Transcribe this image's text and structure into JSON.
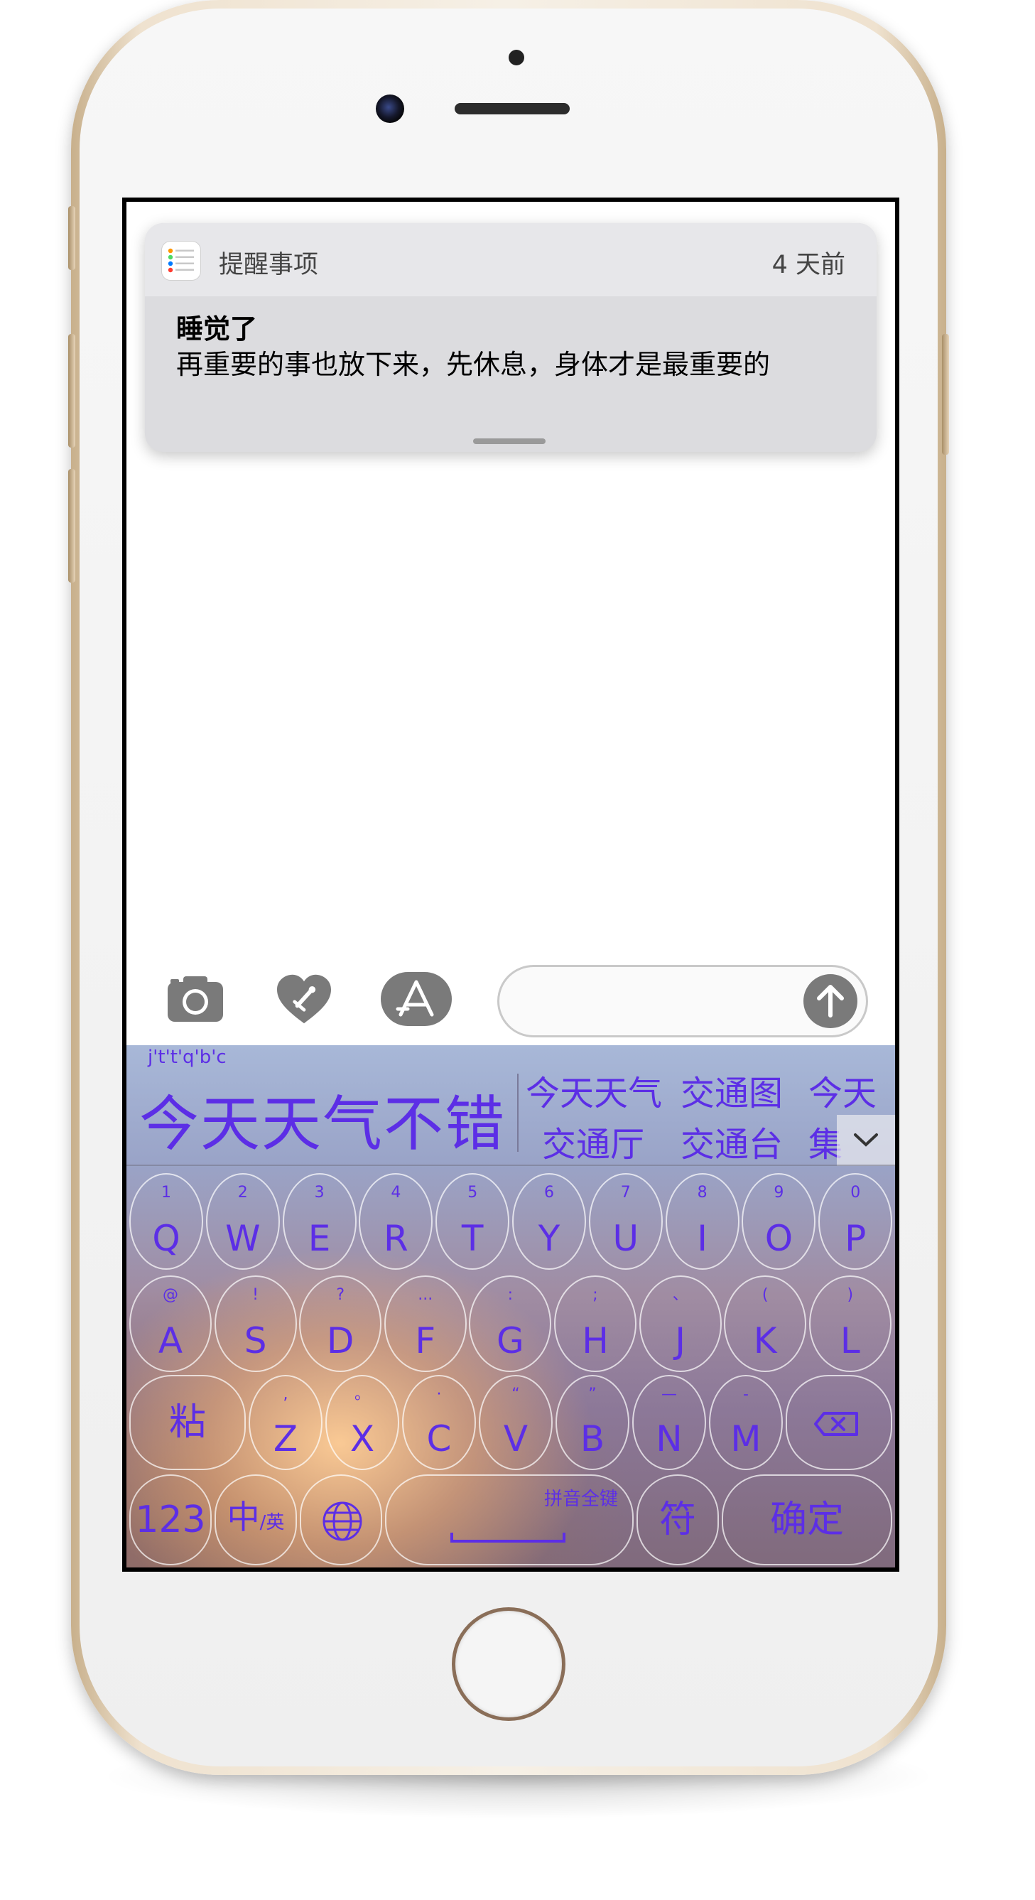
{
  "notification": {
    "app_name": "提醒事项",
    "time_ago": "4 天前",
    "title": "睡觉了",
    "message": "再重要的事也放下来，先休息，身体才是最重要的"
  },
  "message_toolbar": {
    "icons": [
      "camera-icon",
      "heart-icon",
      "app-store-icon"
    ],
    "send_icon": "arrow-up-icon"
  },
  "keyboard": {
    "pinyin": "j't't'q'b'c",
    "main_candidate": "今天天气不错",
    "candidates_row1": [
      "今天天气",
      "交通图",
      "今天"
    ],
    "candidates_row2": [
      "交通厅",
      "交通台",
      "集"
    ],
    "row1": [
      {
        "k": "Q",
        "s": "1"
      },
      {
        "k": "W",
        "s": "2"
      },
      {
        "k": "E",
        "s": "3"
      },
      {
        "k": "R",
        "s": "4"
      },
      {
        "k": "T",
        "s": "5"
      },
      {
        "k": "Y",
        "s": "6"
      },
      {
        "k": "U",
        "s": "7"
      },
      {
        "k": "I",
        "s": "8"
      },
      {
        "k": "O",
        "s": "9"
      },
      {
        "k": "P",
        "s": "0"
      }
    ],
    "row2": [
      {
        "k": "A",
        "s": "@"
      },
      {
        "k": "S",
        "s": "!"
      },
      {
        "k": "D",
        "s": "?"
      },
      {
        "k": "F",
        "s": "..."
      },
      {
        "k": "G",
        "s": ":"
      },
      {
        "k": "H",
        "s": ";"
      },
      {
        "k": "J",
        "s": "、"
      },
      {
        "k": "K",
        "s": "("
      },
      {
        "k": "L",
        "s": ")"
      }
    ],
    "row3": [
      {
        "k": "Z",
        "s": ","
      },
      {
        "k": "X",
        "s": "。"
      },
      {
        "k": "C",
        "s": "·"
      },
      {
        "k": "V",
        "s": "“"
      },
      {
        "k": "B",
        "s": "”"
      },
      {
        "k": "N",
        "s": "—"
      },
      {
        "k": "M",
        "s": "-"
      }
    ],
    "paste": "粘",
    "num": "123",
    "lang_main": "中",
    "lang_sub": "/英",
    "space_label": "拼音全键",
    "symbol": "符",
    "confirm": "确定"
  }
}
